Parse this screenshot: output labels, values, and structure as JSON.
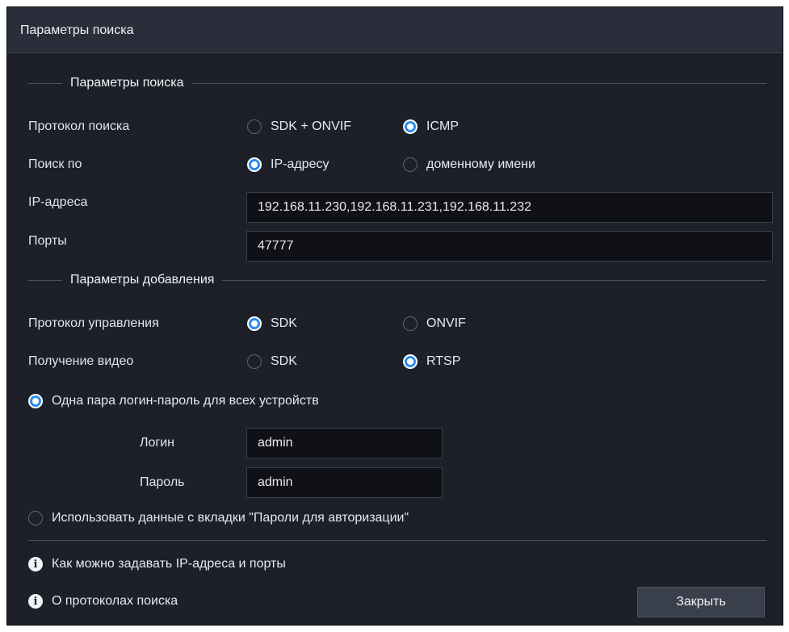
{
  "window": {
    "title": "Параметры поиска"
  },
  "search_section": {
    "legend": "Параметры поиска",
    "protocol": {
      "label": "Протокол поиска",
      "options": [
        "SDK + ONVIF",
        "ICMP"
      ],
      "selected": "ICMP"
    },
    "search_by": {
      "label": "Поиск по",
      "options": [
        "IP-адресу",
        "доменному имени"
      ],
      "selected": "IP-адресу"
    },
    "ip_addresses": {
      "label": "IP-адреса",
      "value": "192.168.11.230,192.168.11.231,192.168.11.232"
    },
    "ports": {
      "label": "Порты",
      "value": "47777"
    }
  },
  "add_section": {
    "legend": "Параметры добавления",
    "control_protocol": {
      "label": "Протокол управления",
      "options": [
        "SDK",
        "ONVIF"
      ],
      "selected": "SDK"
    },
    "video": {
      "label": "Получение видео",
      "options": [
        "SDK",
        "RTSP"
      ],
      "selected": "RTSP"
    }
  },
  "credentials": {
    "single_pair_label": "Одна пара логин-пароль для всех устройств",
    "login_label": "Логин",
    "login_value": "admin",
    "password_label": "Пароль",
    "password_value": "admin",
    "use_tab_label": "Использовать данные с вкладки \"Пароли для авторизации\"",
    "selected": "single_pair"
  },
  "help": {
    "link_ip_ports": "Как можно задавать IP-адреса и порты",
    "link_protocols": "О протоколах поиска"
  },
  "buttons": {
    "close": "Закрыть"
  },
  "colors": {
    "accent": "#2d8cf0",
    "background": "#1d2029",
    "input_bg": "#0f1116"
  }
}
